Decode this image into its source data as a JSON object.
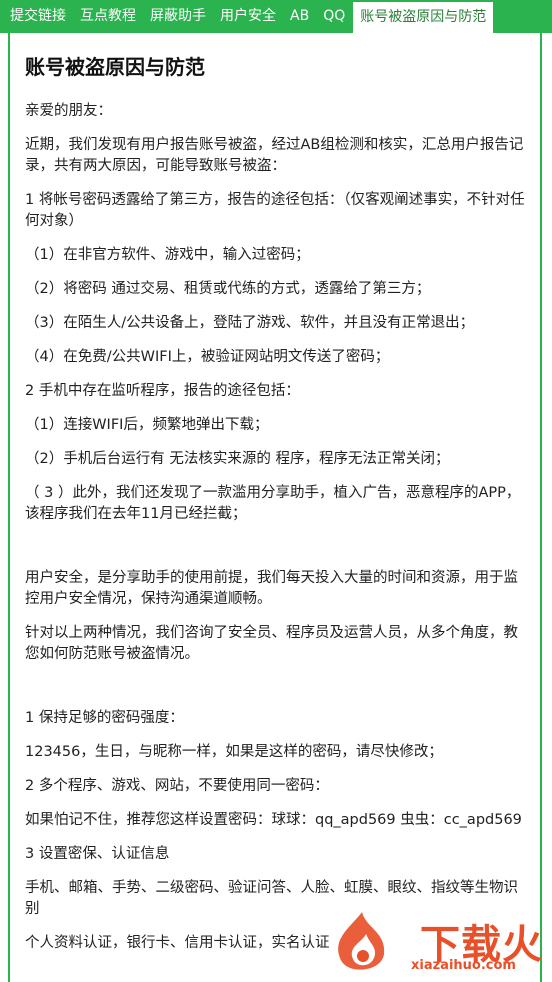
{
  "tabs": [
    "提交链接",
    "互点教程",
    "屏蔽助手",
    "用户安全",
    "AB",
    "QQ",
    "账号被盗原因与防范"
  ],
  "article": {
    "title": "账号被盗原因与防范",
    "paragraphs": [
      "亲爱的朋友：",
      "近期，我们发现有用户报告账号被盗，经过AB组检测和核实，汇总用户报告记录，共有两大原因，可能导致账号被盗：",
      "1  将帐号密码透露给了第三方，报告的途径包括：（仅客观阐述事实，不针对任何对象）",
      "（1）在非官方软件、游戏中，输入过密码；",
      "（2）将密码  通过交易、租赁或代练的方式，透露给了第三方；",
      "（3）在陌生人/公共设备上，登陆了游戏、软件，并且没有正常退出；",
      "（4）在免费/公共WIFI上，被验证网站明文传送了密码；",
      "2  手机中存在监听程序，报告的途径包括：",
      "（1）连接WIFI后，频繁地弹出下载；",
      "（2）手机后台运行有  无法核实来源的  程序，程序无法正常关闭；",
      "（ 3 ）此外，我们还发现了一款滥用分享助手，植入广告，恶意程序的APP，该程序我们在去年11月已经拦截；"
    ],
    "paragraphs2": [
      "用户安全，是分享助手的使用前提，我们每天投入大量的时间和资源，用于监控用户安全情况，保持沟通渠道顺畅。",
      "针对以上两种情况，我们咨询了安全员、程序员及运营人员，从多个角度，教您如何防范账号被盗情况。"
    ],
    "paragraphs3": [
      "1  保持足够的密码强度：",
      "123456，生日，与昵称一样，如果是这样的密码，请尽快修改；",
      "2  多个程序、游戏、网站，不要使用同一密码：",
      "如果怕记不住，推荐您这样设置密码：球球：qq_apd569  虫虫：cc_apd569",
      "3  设置密保、认证信息",
      "手机、邮箱、手势、二级密码、验证问答、人脸、虹膜、眼纹、指纹等生物识别",
      "个人资料认证，银行卡、信用卡认证，实名认证"
    ]
  },
  "watermark": {
    "text": "下载火",
    "url": "xiazaihuo.com",
    "color": "#e8502a"
  },
  "colors": {
    "tabbar": "#2bb34f",
    "active_tab_text": "#2a7f3a"
  }
}
